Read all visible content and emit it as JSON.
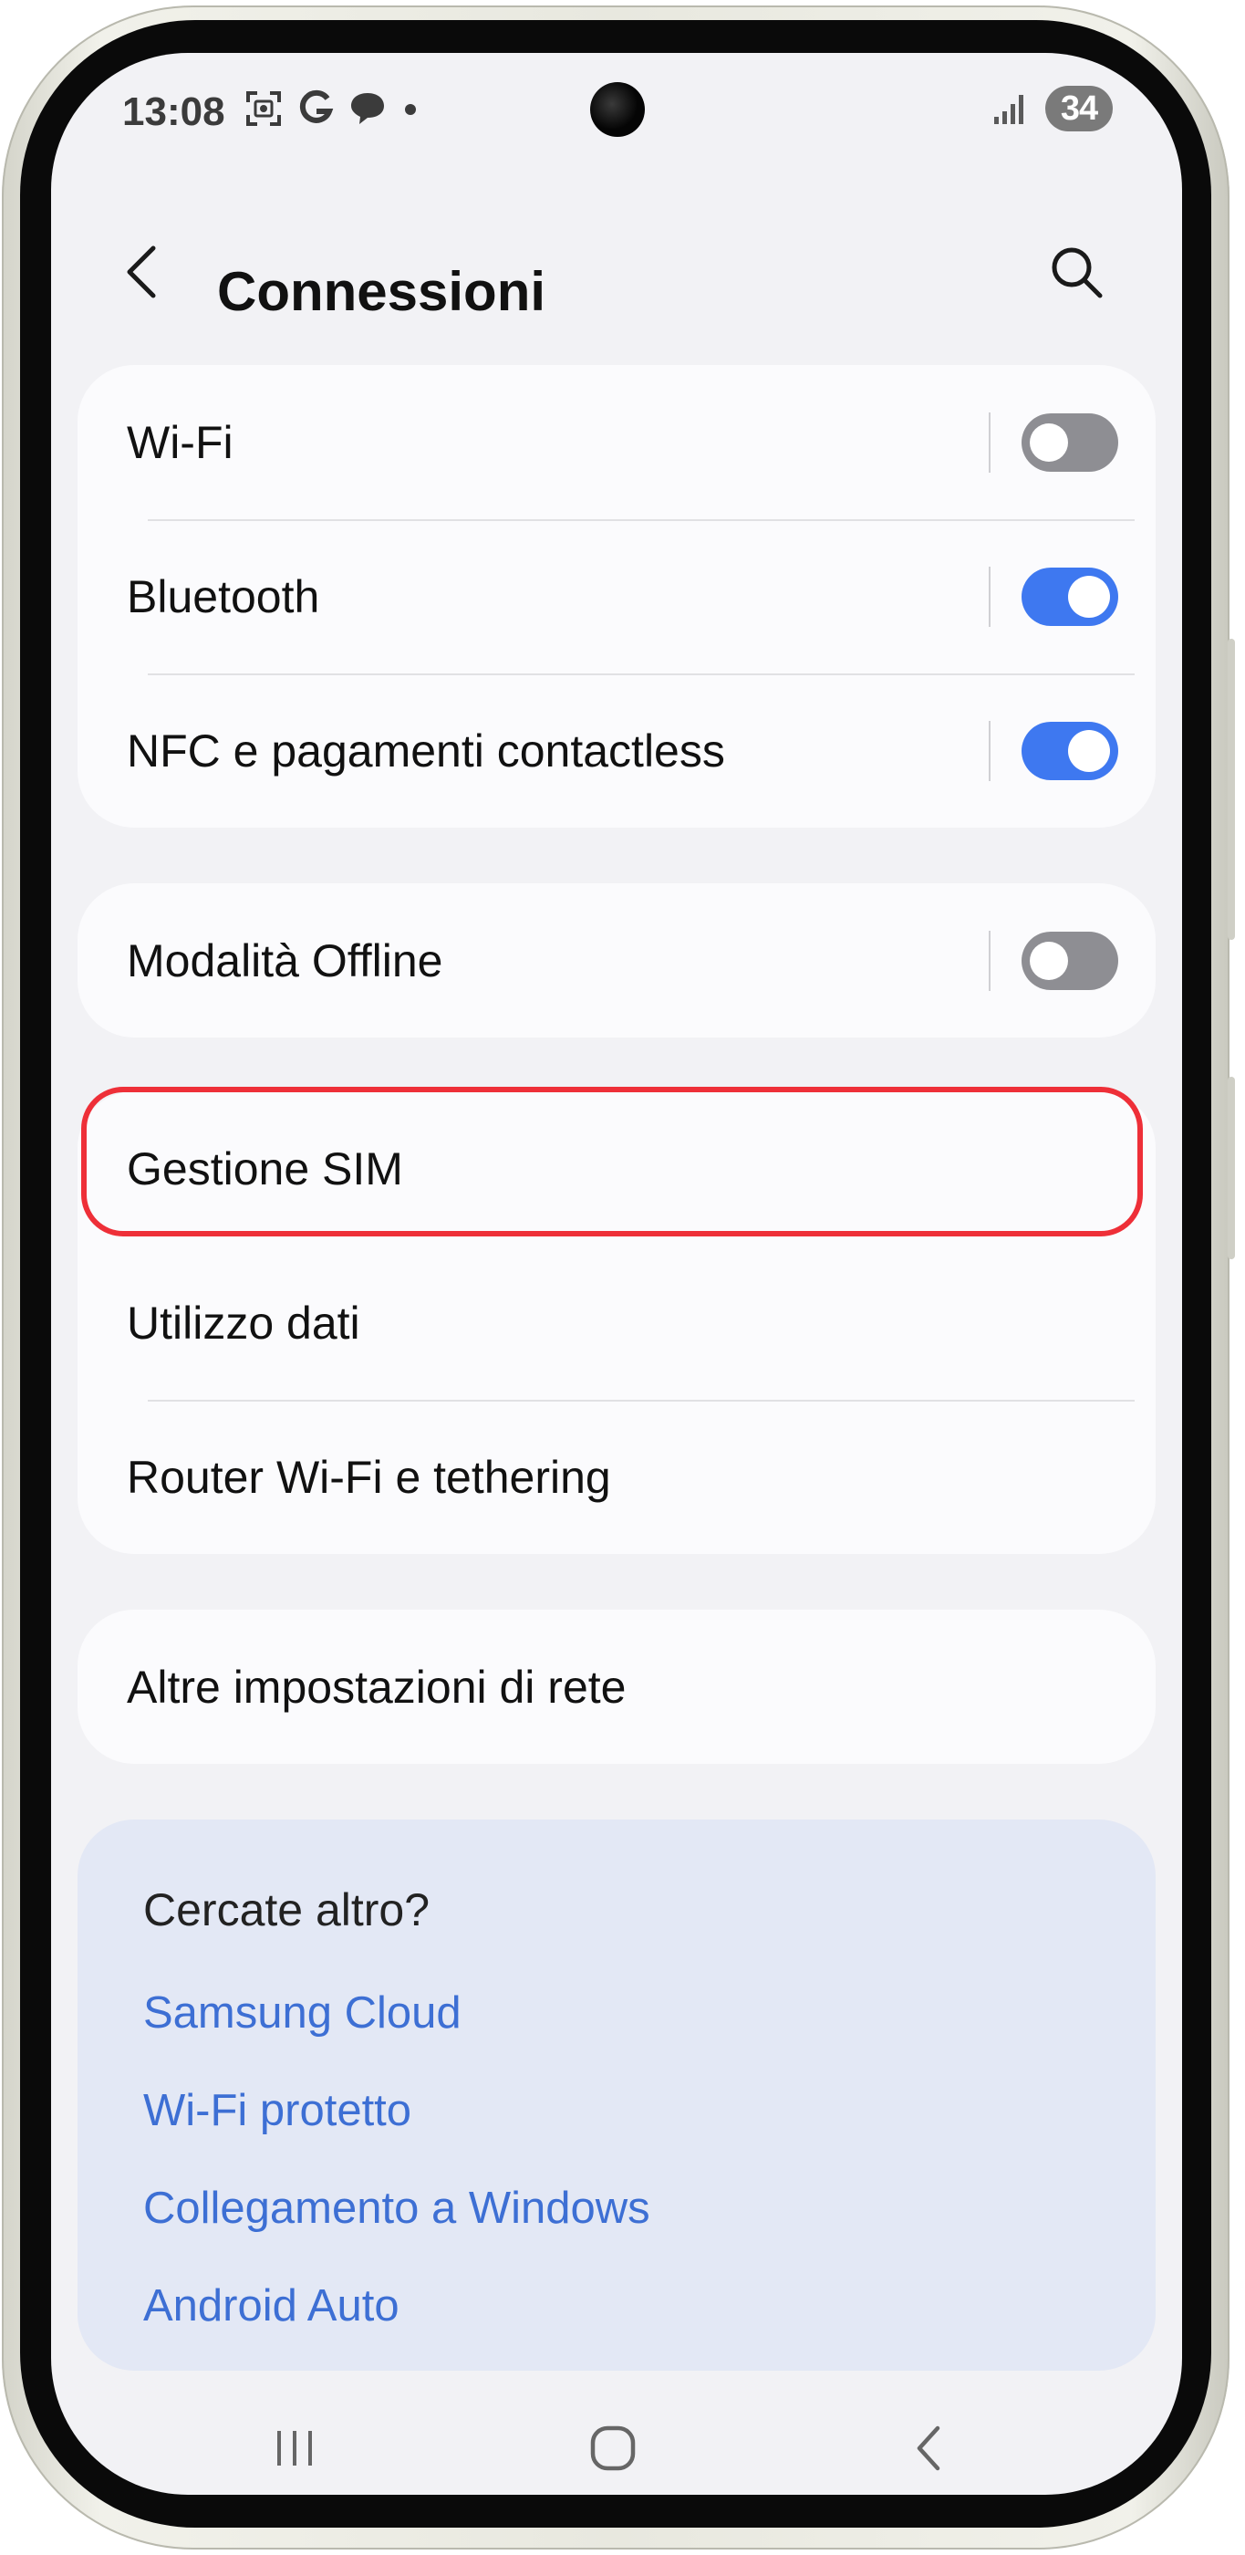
{
  "status_bar": {
    "time": "13:08",
    "battery": "34",
    "icons": [
      "screenshot-icon",
      "google-icon",
      "chat-bubble-icon",
      "notification-dot-icon",
      "signal-icon"
    ]
  },
  "header": {
    "title": "Connessioni",
    "back_icon": "chevron-left-icon",
    "search_icon": "search-icon"
  },
  "groups": {
    "wireless": [
      {
        "label": "Wi-Fi",
        "toggle": "off"
      },
      {
        "label": "Bluetooth",
        "toggle": "on"
      },
      {
        "label": "NFC e pagamenti contactless",
        "toggle": "on"
      }
    ],
    "offline": [
      {
        "label": "Modalità Offline",
        "toggle": "off"
      }
    ],
    "network": [
      {
        "label": "Gestione SIM",
        "highlighted": true
      },
      {
        "label": "Utilizzo dati"
      },
      {
        "label": "Router Wi-Fi e tethering"
      }
    ],
    "more": [
      {
        "label": "Altre impostazioni di rete"
      }
    ]
  },
  "suggestions": {
    "title": "Cercate altro?",
    "links": [
      "Samsung Cloud",
      "Wi-Fi protetto",
      "Collegamento a Windows",
      "Android Auto"
    ]
  },
  "nav_bar": {
    "icons": [
      "recent-apps-icon",
      "home-icon",
      "back-icon"
    ]
  },
  "colors": {
    "accent": "#3e78f0",
    "link": "#3d6fd4",
    "highlight": "#ee2f38",
    "screen_bg": "#f2f2f5",
    "card_bg": "#fbfbfd",
    "suggest_bg": "#e3e8f5"
  }
}
